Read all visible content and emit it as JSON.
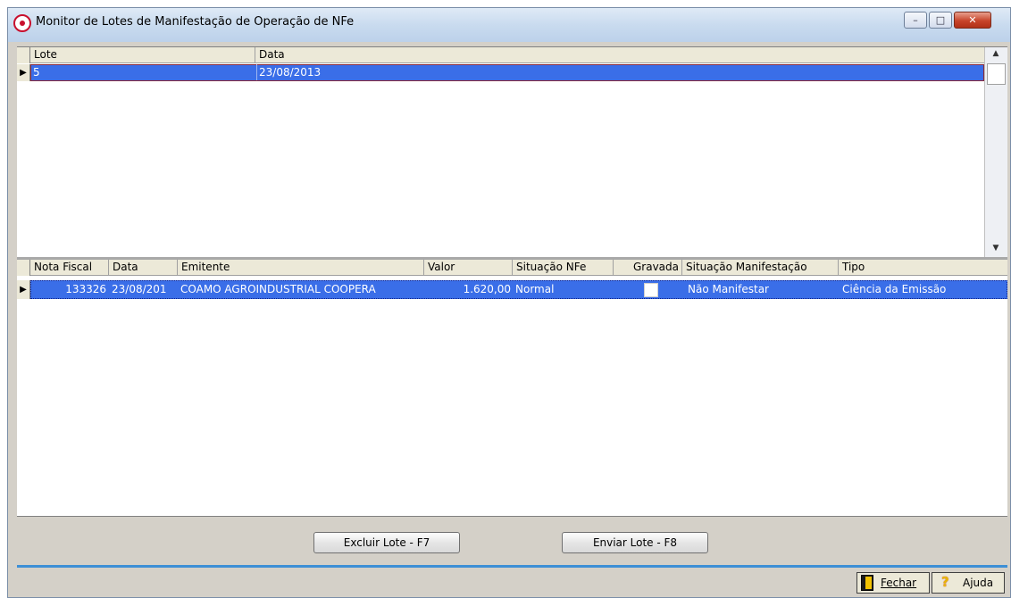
{
  "window": {
    "title": "Monitor de Lotes de Manifestação de Operação de NFe",
    "controls": {
      "minimize": "–",
      "maximize": "□",
      "close": "✕"
    }
  },
  "lotes_grid": {
    "columns": [
      "Lote",
      "Data"
    ],
    "rows": [
      {
        "lote": "5",
        "data": "23/08/2013"
      }
    ]
  },
  "notas_grid": {
    "columns": [
      "Nota Fiscal",
      "Data",
      "Emitente",
      "Valor",
      "Situação NFe",
      "Gravada",
      "Situação Manifestação",
      "Tipo"
    ],
    "rows": [
      {
        "nota_fiscal": "133326",
        "data": "23/08/201",
        "emitente": "COAMO AGROINDUSTRIAL COOPERA",
        "valor": "1.620,00",
        "situacao_nfe": "Normal",
        "gravada": false,
        "situacao_manifestacao": "Não Manifestar",
        "tipo": "Ciência da Emissão"
      }
    ]
  },
  "actions": {
    "excluir": "Excluir Lote - F7",
    "enviar": "Enviar Lote - F8"
  },
  "status_bar": {
    "fechar": "Fechar",
    "ajuda": "Ajuda"
  },
  "colors": {
    "selection": "#3a6ee8",
    "accent_line": "#3d8fd6",
    "panel": "#d4d0c8"
  }
}
